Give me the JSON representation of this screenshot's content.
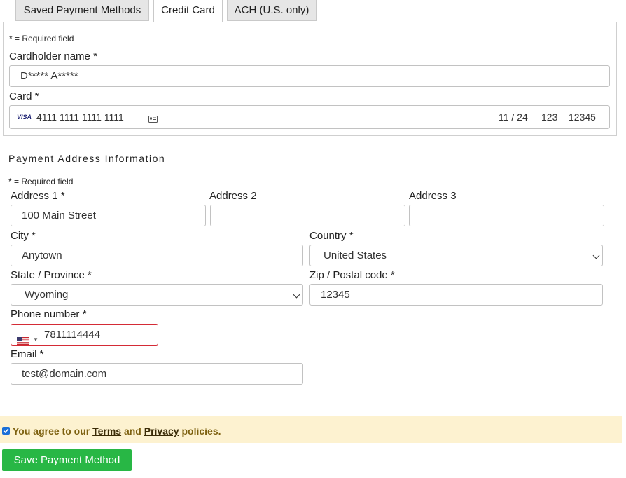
{
  "tabs": [
    {
      "label": "Saved Payment Methods"
    },
    {
      "label": "Credit Card"
    },
    {
      "label": "ACH (U.S. only)"
    }
  ],
  "card_section": {
    "required_note": "* = Required field",
    "cardholder_label": "Cardholder name *",
    "cardholder_value": "D***** A*****",
    "card_label": "Card *",
    "card_brand": "VISA",
    "card_number": "4111 1111 1111 1111",
    "card_expiry": "11 / 24",
    "card_cvc": "123",
    "card_zip": "12345"
  },
  "address_section": {
    "title": "Payment Address Information",
    "required_note": "* = Required field",
    "address1_label": "Address 1 *",
    "address1_value": "100 Main Street",
    "address2_label": "Address 2",
    "address2_value": "",
    "address3_label": "Address 3",
    "address3_value": "",
    "city_label": "City *",
    "city_value": "Anytown",
    "country_label": "Country *",
    "country_value": "United States",
    "state_label": "State / Province *",
    "state_value": "Wyoming",
    "zip_label": "Zip / Postal code *",
    "zip_value": "12345",
    "phone_label": "Phone number *",
    "phone_value": "7811114444",
    "email_label": "Email *",
    "email_value": "test@domain.com"
  },
  "agreement": {
    "checked": true,
    "prefix": "You agree to our ",
    "terms": "Terms",
    "and": " and ",
    "privacy": "Privacy",
    "suffix": " policies."
  },
  "save_button_label": "Save Payment Method",
  "colors": {
    "save_button": "#28b745",
    "agree_background": "#fdf2d0",
    "error_border": "#d42b36"
  }
}
